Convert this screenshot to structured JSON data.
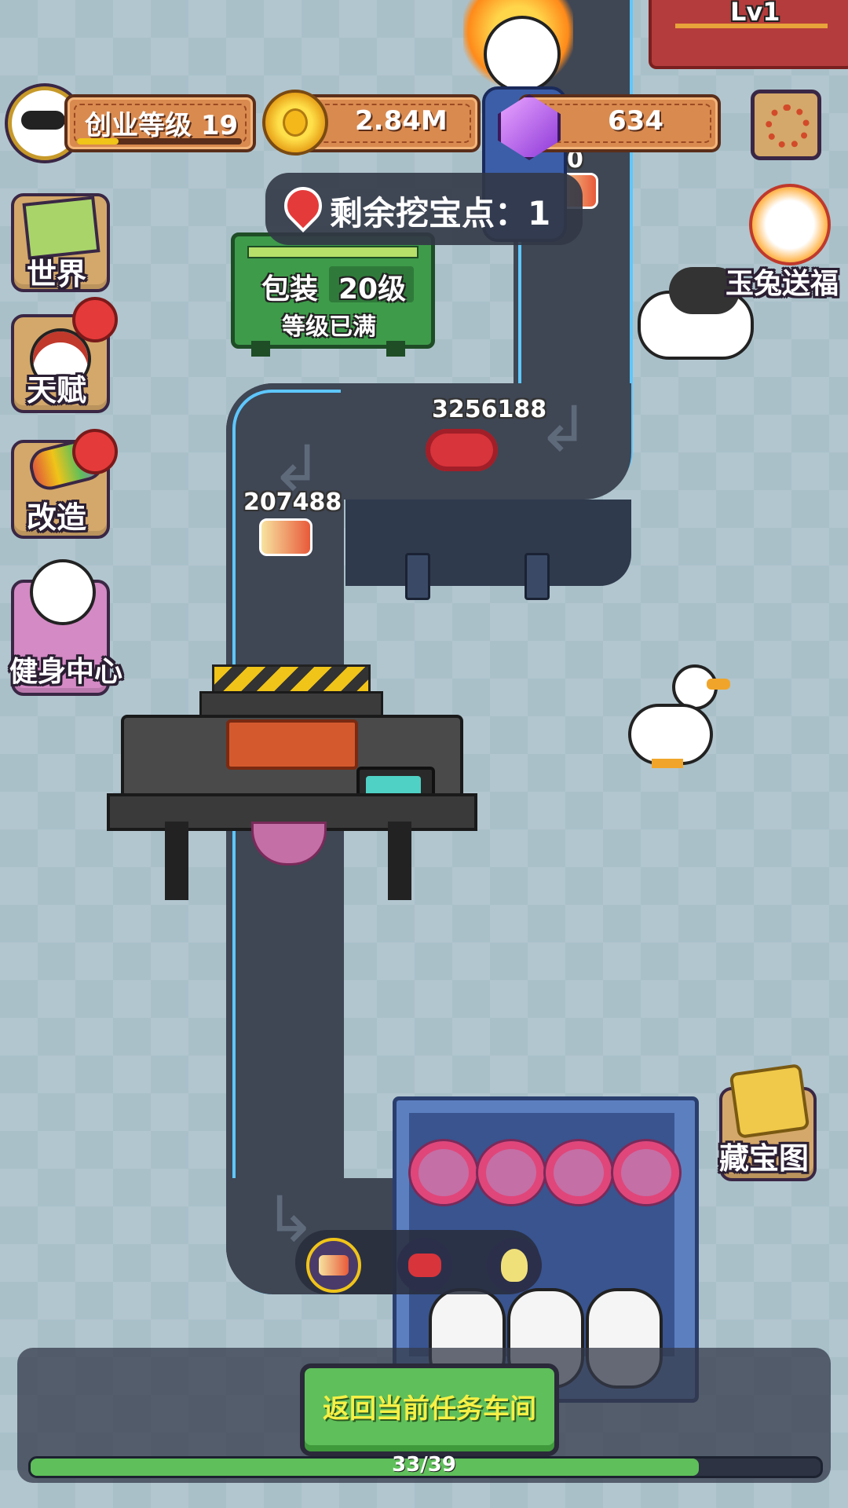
{
  "player": {
    "level_label": "创业等级 19",
    "level_progress": 0.25
  },
  "currency": {
    "coins": "2.84M",
    "gems": "634"
  },
  "building_level": "Lv1",
  "dig_points": {
    "label": "剩余挖宝点：1"
  },
  "station": {
    "name": "包装",
    "level": "20级",
    "status": "等级已满"
  },
  "left_menu": [
    {
      "label": "世界",
      "icon": "world-map-icon"
    },
    {
      "label": "天赋",
      "icon": "talent-icon",
      "badge": true
    },
    {
      "label": "改造",
      "icon": "modify-icon",
      "badge": true
    },
    {
      "label": "健身中心",
      "icon": "gym-icon"
    }
  ],
  "right_menu": [
    {
      "label": "玉兔送福",
      "icon": "jade-rabbit-icon"
    },
    {
      "label": "藏宝图",
      "icon": "treasure-map-icon"
    }
  ],
  "belt_counters": [
    {
      "value": "0"
    },
    {
      "value": "3256188"
    },
    {
      "value": "207488"
    }
  ],
  "product_slots": [
    {
      "icon": "popsicle-icon",
      "selected": true
    },
    {
      "icon": "sausage-icon",
      "selected": false
    },
    {
      "icon": "lemon-bag-icon",
      "selected": false
    }
  ],
  "return_button": "返回当前任务车间",
  "task_progress": {
    "text": "33/39",
    "value": 33,
    "max": 39
  },
  "colors": {
    "accent_green": "#5fbf5a",
    "bar_orange": "#d98a4f",
    "belt_blue": "#5ec7ff",
    "station_green": "#3e9b4a",
    "gem_purple": "#b45cf0"
  }
}
